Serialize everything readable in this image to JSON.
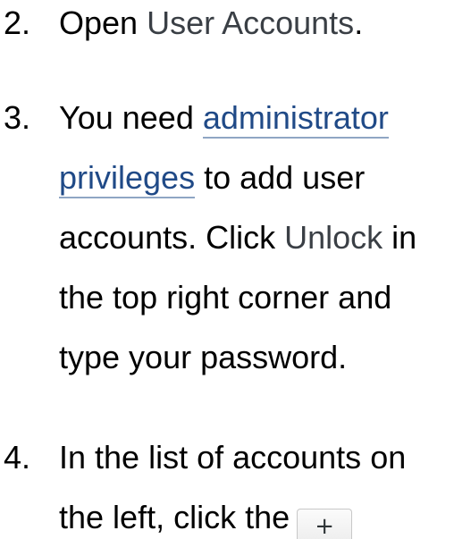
{
  "steps": [
    {
      "number": "2.",
      "lead": "Open ",
      "gui": "User Accounts",
      "tail": "."
    },
    {
      "number": "3.",
      "lead": "You need ",
      "link": "administrator privileges",
      "mid": " to add user accounts. Click ",
      "gui": "Unlock",
      "tail": " in the top right corner and type your password."
    },
    {
      "number": "4.",
      "lead": "In the list of accounts on the left, click the",
      "button_label": "+"
    }
  ],
  "colors": {
    "text": "#000000",
    "gui_label": "#3a3f45",
    "link": "#204a87",
    "link_underline": "#8fa6c4"
  },
  "icons": {
    "add": "plus-button"
  }
}
